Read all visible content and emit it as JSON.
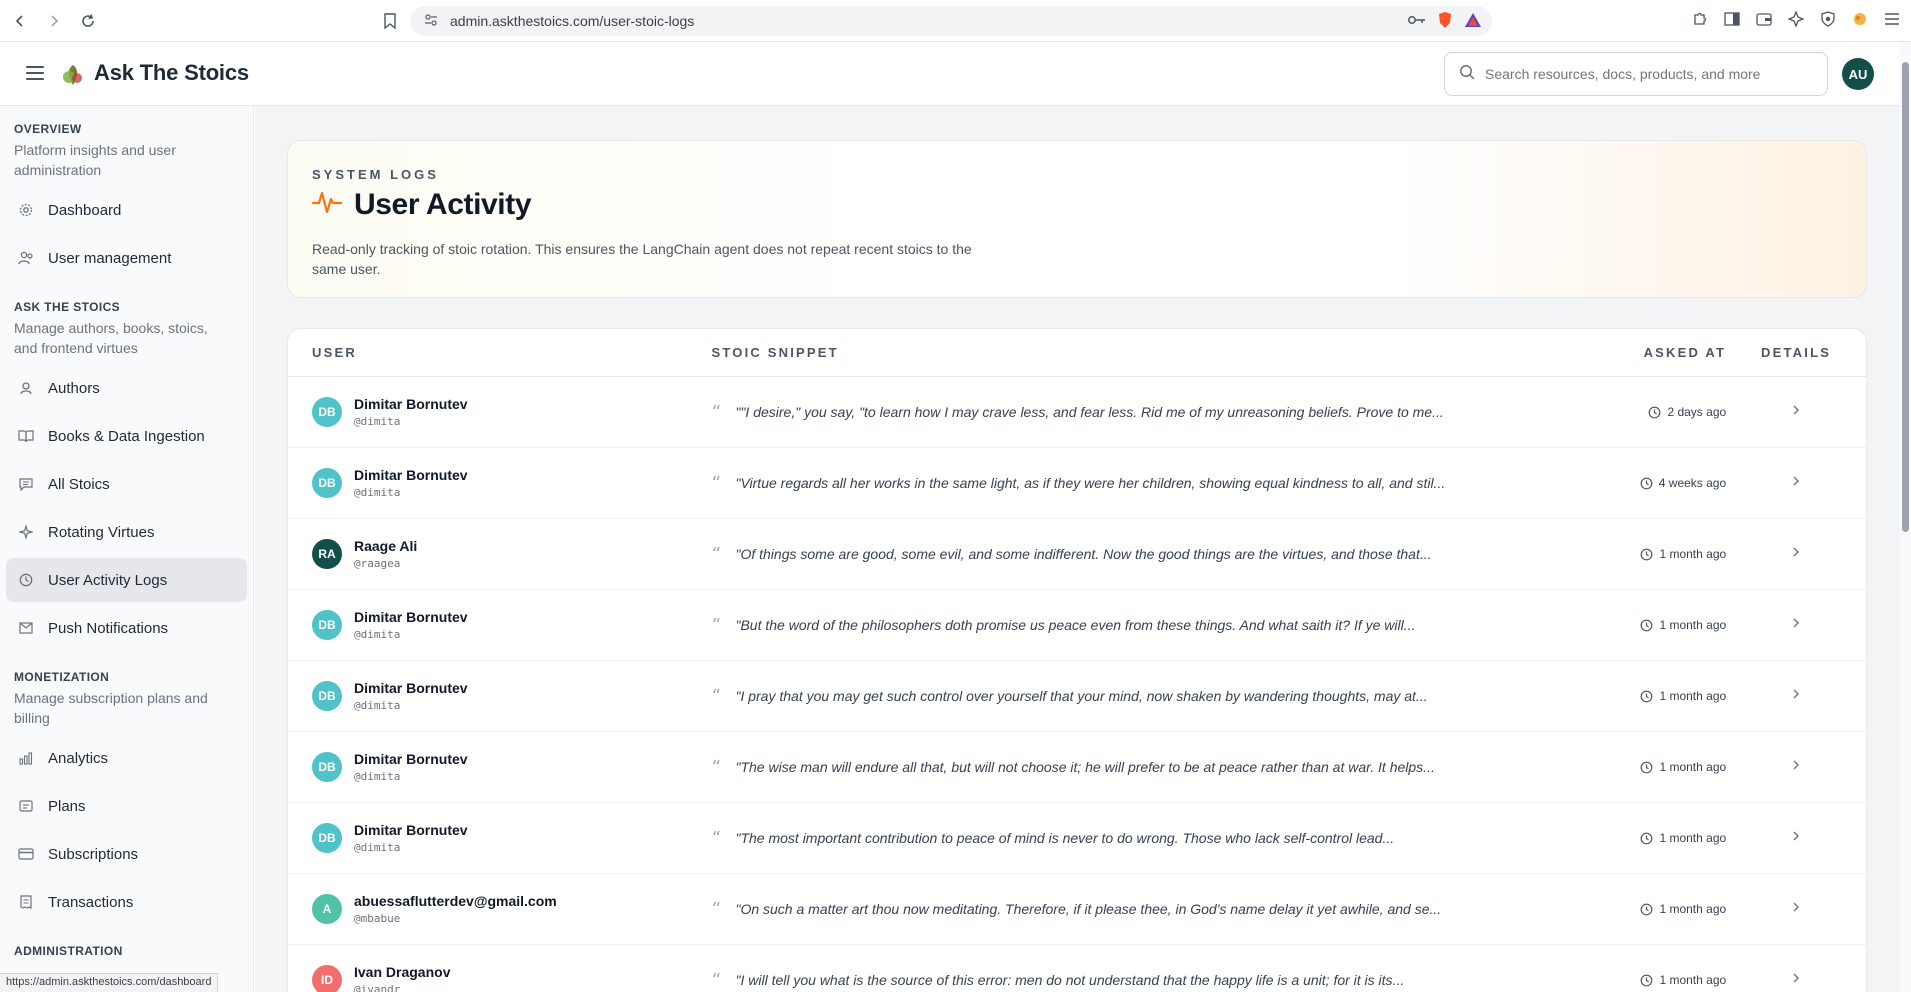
{
  "browser": {
    "url": "admin.askthestoics.com/user-stoic-logs",
    "status_url": "https://admin.askthestoics.com/dashboard"
  },
  "header": {
    "brand": "Ask The Stoics",
    "search_placeholder": "Search resources, docs, products, and more",
    "avatar_initials": "AU"
  },
  "sidebar": {
    "sections": [
      {
        "title": "OVERVIEW",
        "desc": "Platform insights and user administration",
        "items": [
          {
            "label": "Dashboard",
            "icon": "gear-icon"
          },
          {
            "label": "User management",
            "icon": "users-icon"
          }
        ]
      },
      {
        "title": "ASK THE STOICS",
        "desc": "Manage authors, books, stoics, and frontend virtues",
        "items": [
          {
            "label": "Authors",
            "icon": "author-icon"
          },
          {
            "label": "Books & Data Ingestion",
            "icon": "book-icon"
          },
          {
            "label": "All Stoics",
            "icon": "chat-icon"
          },
          {
            "label": "Rotating Virtues",
            "icon": "sparkle-icon"
          },
          {
            "label": "User Activity Logs",
            "icon": "clock-icon",
            "active": true
          },
          {
            "label": "Push Notifications",
            "icon": "mail-icon"
          }
        ]
      },
      {
        "title": "MONETIZATION",
        "desc": "Manage subscription plans and billing",
        "items": [
          {
            "label": "Analytics",
            "icon": "bar-chart-icon"
          },
          {
            "label": "Plans",
            "icon": "plans-icon"
          },
          {
            "label": "Subscriptions",
            "icon": "card-icon"
          },
          {
            "label": "Transactions",
            "icon": "receipt-icon"
          }
        ]
      },
      {
        "title": "ADMINISTRATION",
        "desc": "",
        "items": []
      }
    ]
  },
  "hero": {
    "eyebrow": "SYSTEM LOGS",
    "title": "User Activity",
    "desc": "Read-only tracking of stoic rotation. This ensures the LangChain agent does not repeat recent stoics to the same user."
  },
  "table": {
    "columns": [
      "USER",
      "STOIC SNIPPET",
      "ASKED AT",
      "DETAILS"
    ],
    "rows": [
      {
        "initials": "DB",
        "color": "#4fc3c9",
        "name": "Dimitar Bornutev",
        "handle": "@dimita",
        "snippet": "\"\"I desire,\" you say, \"to learn how I may crave less, and fear less. Rid me of my unreasoning beliefs. Prove to me...",
        "asked": "2 days ago"
      },
      {
        "initials": "DB",
        "color": "#4fc3c9",
        "name": "Dimitar Bornutev",
        "handle": "@dimita",
        "snippet": "\"Virtue regards all her works in the same light, as if they were her children, showing equal kindness to all, and stil...",
        "asked": "4 weeks ago"
      },
      {
        "initials": "RA",
        "color": "#134e4a",
        "name": "Raage Ali",
        "handle": "@raagea",
        "snippet": "\"Of things some are good, some evil, and some indifferent. Now the good things are the virtues, and those that...",
        "asked": "1 month ago"
      },
      {
        "initials": "DB",
        "color": "#4fc3c9",
        "name": "Dimitar Bornutev",
        "handle": "@dimita",
        "snippet": "\"But the word of the philosophers doth promise us peace even from these things. And what saith it? If ye will...",
        "asked": "1 month ago"
      },
      {
        "initials": "DB",
        "color": "#4fc3c9",
        "name": "Dimitar Bornutev",
        "handle": "@dimita",
        "snippet": "\"I pray that you may get such control over yourself that your mind, now shaken by wandering thoughts, may at...",
        "asked": "1 month ago"
      },
      {
        "initials": "DB",
        "color": "#4fc3c9",
        "name": "Dimitar Bornutev",
        "handle": "@dimita",
        "snippet": "\"The wise man will endure all that, but will not choose it; he will prefer to be at peace rather than at war. It helps...",
        "asked": "1 month ago"
      },
      {
        "initials": "DB",
        "color": "#4fc3c9",
        "name": "Dimitar Bornutev",
        "handle": "@dimita",
        "snippet": "\"The most important contribution to peace of mind is never to do wrong. Those who lack self-control lead...",
        "asked": "1 month ago"
      },
      {
        "initials": "A",
        "color": "#4fc3a4",
        "name": "abuessaflutterdev@gmail.com",
        "handle": "@mbabue",
        "snippet": "\"On such a matter art thou now meditating. Therefore, if it please thee, in God's name delay it yet awhile, and se...",
        "asked": "1 month ago"
      },
      {
        "initials": "ID",
        "color": "#f26d6d",
        "name": "Ivan Draganov",
        "handle": "@ivandr",
        "snippet": "\"I will tell you what is the source of this error: men do not understand that the happy life is a unit; for it is its...",
        "asked": "1 month ago"
      }
    ]
  },
  "colors": {
    "accent_orange": "#f97316",
    "active_nav_bg": "#e5e7eb",
    "avatar_top": "#134e4a"
  }
}
